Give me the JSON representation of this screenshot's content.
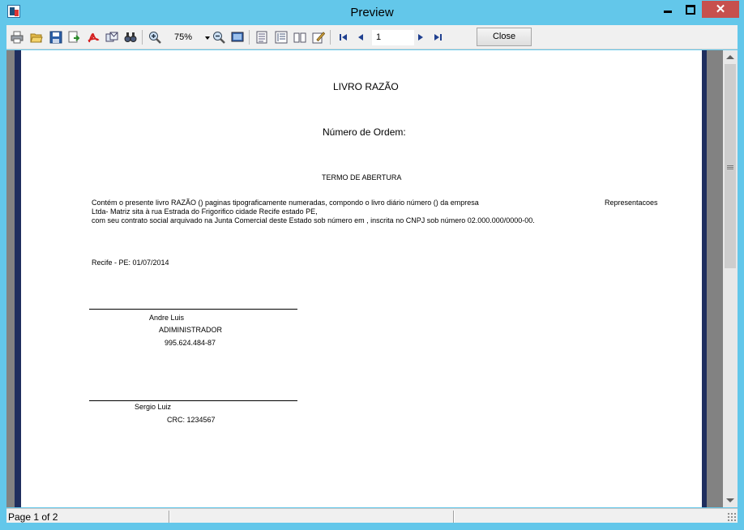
{
  "window": {
    "title": "Preview"
  },
  "toolbar": {
    "zoom_value": "75%",
    "page_number": "1",
    "close_label": "Close"
  },
  "icons": {
    "print": "print-icon",
    "open": "open-folder-icon",
    "save": "save-icon",
    "export": "export-icon",
    "pdf": "pdf-icon",
    "email": "email-icon",
    "find": "find-icon",
    "zoom_in": "zoom-in-icon",
    "zoom_out": "zoom-out-icon",
    "full_screen": "full-screen-icon",
    "outline": "outline-icon",
    "thumbnails": "thumbnails-icon",
    "page_setup": "page-setup-icon",
    "edit": "edit-icon",
    "first": "first-page-icon",
    "prev": "prev-page-icon",
    "next": "next-page-icon",
    "last": "last-page-icon"
  },
  "document": {
    "title": "LIVRO RAZÃO",
    "order_number_label": "Número de Ordem:",
    "section_title": "TERMO DE ABERTURA",
    "paragraph_line1": "Contém o presente livro RAZÃO  () paginas tipograficamente numeradas, compondo o livro diário número () da empresa",
    "paragraph_company": "Representacoes",
    "paragraph_line2": "Ltda- Matriz sita à rua Estrada do Frigorifico cidade Recife estado PE,",
    "paragraph_line3": "com seu contrato social arquivado na Junta Comercial deste Estado sob número  em , inscrita no CNPJ sob número 02.000.000/0000-00.",
    "place_date": "Recife - PE: 01/07/2014",
    "signer1_name": "Andre Luis",
    "signer1_role": "ADIMINISTRADOR",
    "signer1_cpf": "995.624.484-87",
    "signer2_name": "Sergio Luiz",
    "signer2_crc": "CRC: 1234567"
  },
  "status": {
    "page_info": "Page 1 of 2"
  },
  "colors": {
    "titlebar": "#63c7ea",
    "close_button": "#c7504d",
    "preview_bg": "#828282",
    "page_border": "#1f2e5e"
  }
}
